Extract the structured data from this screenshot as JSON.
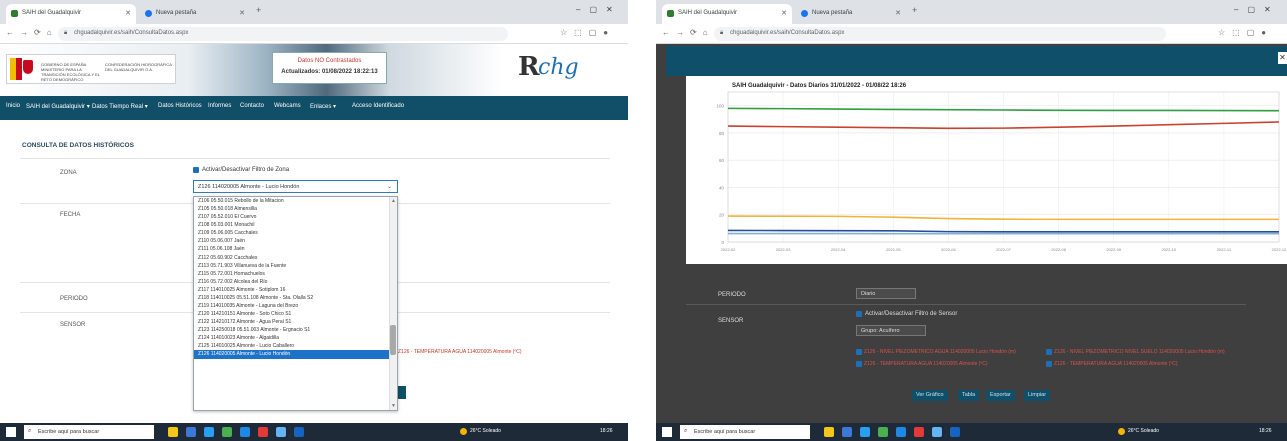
{
  "left": {
    "tabs": [
      {
        "label": "SAIH del Guadalquivir"
      },
      {
        "label": "Nueva pestaña"
      }
    ],
    "address": "chguadalquivir.es/saih/ConsultaDatos.aspx",
    "header": {
      "gov_text_1": "GOBIERNO DE ESPAÑA MINISTERIO PARA LA TRANSICIÓN ECOLÓGICA Y EL RETO DEMOGRÁFICO",
      "gov_text_2": "CONFEDERACIÓN HIDROGRÁFICA DEL GUADALQUIVIR O.A.",
      "info_line_1": "Datos NO Contrastados",
      "info_line_2": "Actualizados: 01/08/2022 18:22:13"
    },
    "nav": [
      "Inicio",
      "SAIH del Guadalquivir ▾",
      "Datos Tiempo Real ▾",
      "Datos Históricos",
      "Informes",
      "Contacto",
      "Webcams",
      "Enlaces ▾",
      "Acceso Identificado"
    ],
    "section_title": "CONSULTA DE DATOS HISTÓRICOS",
    "fields": {
      "zona": "ZONA",
      "fecha": "FECHA",
      "periodo": "PERIODO",
      "sensor": "SENSOR"
    },
    "zone_filter_label": "Activar/Desactivar Filtro de Zona",
    "zone_selected": "Z126 114020005 Almonte - Lucio Hondón",
    "dropdown_items": [
      "Z106 05.50.015 Rebollo de la Mitacion",
      "Z105 05.50.018 Almensilla",
      "Z107 05.52.010 El Cuervo",
      "Z108 05.03.001 Monachil",
      "Z109 05.06.005 Cacchales",
      "Z110 05.06.007 Jaén",
      "Z111 05.06.108 Jaén",
      "Z112 05.60.902 Cacchales",
      "Z113 05.71.903 Villanueva de la Fuente",
      "Z115 05.72.001 Hornachuelos",
      "Z116 05.72.002 Alcolea del Río",
      "Z117 114010025 Almonte - Sotiplom 16",
      "Z118 114010025 05.51.108 Almonte - Sta. Olalla S2",
      "Z119 114010035 Almonte - Laguna del Brezo",
      "Z120 114210151 Almonte - Soto Chico S1",
      "Z122 114210172 Almonte - Agua Peral S1",
      "Z123 114250018 05.51.003 Almonte - Ergnacio S1",
      "Z124 114010023 Almonte - Algaidilla",
      "Z125 114010025 Almonte - Lucio Caballero",
      "Z126 114020005 Almonte - Lucio Hondón"
    ],
    "sensor_red": "Z126 - TEMPERATURA AGUA 114020005 Almonte (ºC)",
    "taskbar": {
      "search": "Escribe aquí para buscar",
      "weather": "26°C Soleado",
      "time": "18:26"
    }
  },
  "right": {
    "tabs": [
      {
        "label": "SAIH del Guadalquivir"
      },
      {
        "label": "Nueva pestaña"
      }
    ],
    "address": "chguadalquivir.es/saih/ConsultaDatos.aspx",
    "periodo_label": "PERIODO",
    "periodo_value": "Diario",
    "sensor_label": "SENSOR",
    "sensor_filter_label": "Activar/Desactivar Filtro de Sensor",
    "sensor_select": "Grupo: Acuífero",
    "sensors": [
      "Z126 - NIVEL PIEZOMETRICO AGUA 114020005 Lucio Hondón (m)",
      "Z126 - NIVEL PIEZOMETRICO NIVEL SUELO 114020005 Lucio Hondón (m)",
      "Z126 - TEMPERATURA AGUA 114020005 Almonte (ºC)",
      "Z126 - TEMPERATURA AGUA 114020005 Almonte (ºC)"
    ],
    "buttons": [
      "Ver Gráfico",
      "Tabla",
      "Exportar",
      "Limpiar"
    ],
    "taskbar": {
      "search": "Escribe aquí para buscar",
      "weather": "26°C Soleado",
      "time": "18:26"
    }
  },
  "chart_data": {
    "type": "line",
    "title": "SAIH Guadalquivir - Datos Diarios 31/01/2022 - 01/08/22 18:26",
    "xlabel": "",
    "ylabel": "",
    "ylim": [
      0,
      110
    ],
    "x": [
      "2022-02",
      "2022-03",
      "2022-04",
      "2022-05",
      "2022-06",
      "2022-07",
      "2022-08",
      "2022-09",
      "2022-10",
      "2022-11",
      "2022-12"
    ],
    "series": [
      {
        "values": [
          98,
          97.8,
          97.5,
          97.2,
          97,
          96.8,
          96.6,
          96.5,
          96.5,
          96.4,
          96.3
        ],
        "color": "#2e9e3e"
      },
      {
        "values": [
          85,
          84.6,
          84.2,
          83.8,
          83.4,
          83.5,
          84.2,
          85,
          86,
          87,
          88
        ],
        "color": "#c9412f"
      },
      {
        "values": [
          19,
          18.9,
          18.8,
          18.2,
          17.2,
          16.7,
          16.6,
          16.6,
          16.6,
          16.6,
          16.6
        ],
        "color": "#f0b33b"
      },
      {
        "values": [
          8.5,
          8.4,
          8.3,
          8.2,
          7.6,
          7.5,
          7.5,
          7.5,
          7.5,
          7.5,
          7.5
        ],
        "color": "#2b4c9b"
      },
      {
        "values": [
          6.2,
          6.2,
          6.2,
          6.1,
          6.1,
          6.1,
          6.1,
          6.1,
          6.1,
          6.1,
          6.1
        ],
        "color": "#7fb3d5"
      }
    ],
    "grid": true
  }
}
